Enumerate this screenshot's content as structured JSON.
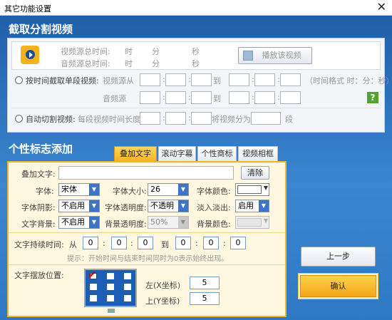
{
  "window": {
    "title": "其它功能设置",
    "close_glyph": "✕"
  },
  "section1": {
    "heading": "截取分割视频",
    "info": {
      "video_total_label": "视频源总时间:",
      "audio_total_label": "音频源总时间:",
      "hour": "时",
      "minute": "分",
      "second": "秒"
    },
    "play_button_label": "播放该视频",
    "by_time": {
      "label": "按时间截取单段视频:",
      "video_source": "视频源",
      "audio_source": "音频源",
      "from": "从",
      "to": "到",
      "format_hint": "（时间格式 时：分：秒）",
      "colon": ":"
    },
    "auto_cut": {
      "label": "自动切割视频:",
      "segment_length": "每段视频时间长度",
      "split_into": "将视频分为",
      "segments": "段"
    },
    "help_glyph": "?"
  },
  "section2": {
    "heading": "个性标志添加",
    "tabs": [
      {
        "label": "叠加文字",
        "active": true
      },
      {
        "label": "滚动字幕",
        "active": false
      },
      {
        "label": "个性商标",
        "active": false
      },
      {
        "label": "视频相框",
        "active": false
      }
    ],
    "overlay_text_label": "叠加文字:",
    "overlay_text_value": "",
    "clear_button": "清除",
    "font_label": "字体:",
    "font_value": "宋体",
    "font_size_label": "字体大小:",
    "font_size_value": "26",
    "font_color_label": "字体颜色:",
    "font_color_value": "#ffffff",
    "shadow_label": "字体阴影:",
    "shadow_value": "不启用",
    "transparency_label": "字体透明度:",
    "transparency_value": "不透明",
    "fade_label": "淡入淡出:",
    "fade_value": "启用",
    "bg_label": "文字背景:",
    "bg_value": "不启用",
    "bg_transparency_label": "背景透明度:",
    "bg_transparency_value": "50%",
    "bg_color_label": "背景颜色:",
    "duration_label": "文字持续时间:",
    "from": "从",
    "to": "到",
    "colon": ":",
    "time_from": [
      "0",
      "0",
      "0"
    ],
    "time_to": [
      "0",
      "0",
      "0"
    ],
    "hint": "提示：开始时间与结束时间同时为0表示始终出现。",
    "position_label": "文字摆放位置:",
    "left_label": "左(X坐标)",
    "left_value": "5",
    "top_label": "上(Y坐标)",
    "top_value": "5"
  },
  "buttons": {
    "prev": "上一步",
    "ok": "确认"
  }
}
